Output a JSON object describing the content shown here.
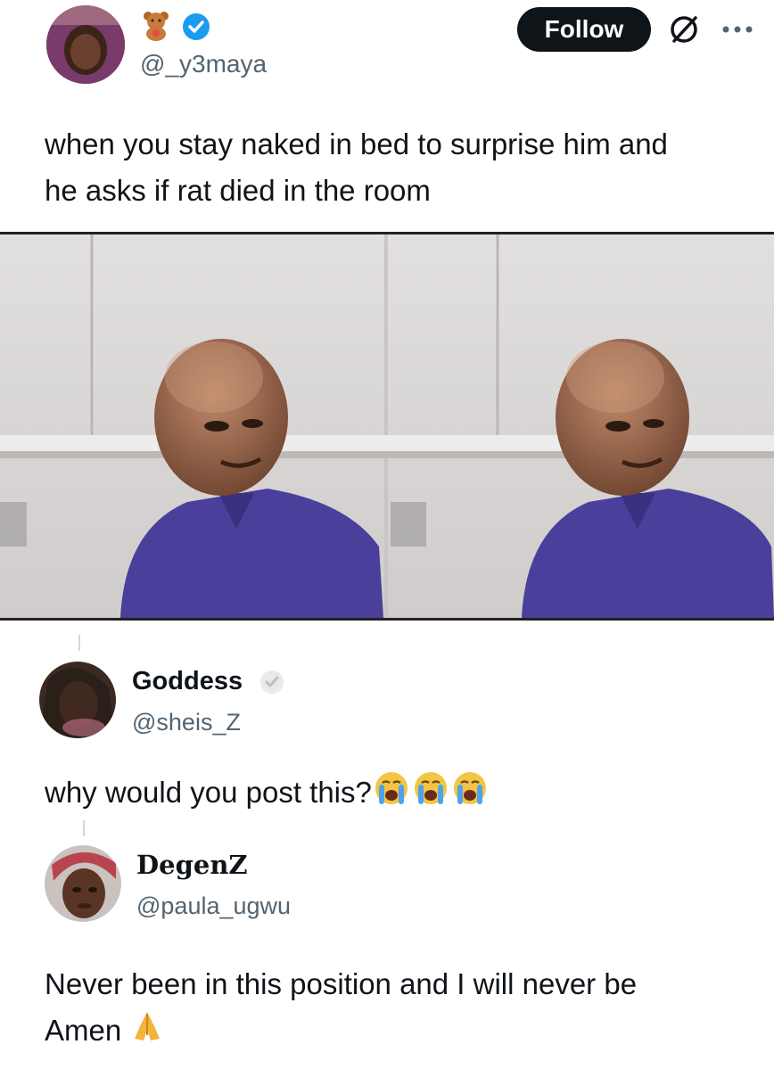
{
  "main_post": {
    "handle": "@_y3maya",
    "follow_label": "Follow",
    "text_line1": "when you stay naked in bed to surprise him and",
    "text_line2": "he asks if rat died in the room",
    "verified_color": "#1d9bf0",
    "icons": [
      "teddy-bear-icon",
      "verified-badge-icon",
      "no-entry-icon",
      "more-icon"
    ]
  },
  "reply1": {
    "name": "Goddess",
    "handle": "@sheis_Z",
    "text": "why would you post this?",
    "emoji": [
      "crying-face-icon",
      "crying-face-icon",
      "crying-face-icon"
    ]
  },
  "reply2": {
    "name": "DegenZ",
    "handle": "@paula_ugwu",
    "text_line1": "Never been in this position and I will never be",
    "text_line2": "Amen",
    "emoji": [
      "praying-hands-icon"
    ]
  }
}
